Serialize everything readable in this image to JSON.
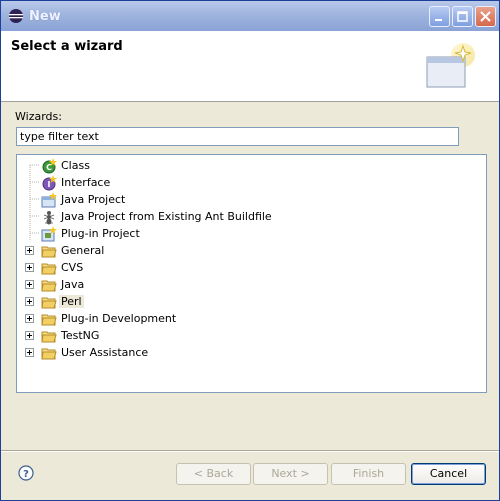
{
  "window": {
    "title": "New"
  },
  "header": {
    "title": "Select a wizard"
  },
  "wizards": {
    "label": "Wizards:",
    "filter_value": "type filter text",
    "tree": {
      "children": [
        {
          "label": "Class",
          "icon": "class-icon"
        },
        {
          "label": "Interface",
          "icon": "interface-icon"
        },
        {
          "label": "Java Project",
          "icon": "java-project-icon"
        },
        {
          "label": "Java Project from Existing Ant Buildfile",
          "icon": "ant-icon"
        },
        {
          "label": "Plug-in Project",
          "icon": "plugin-project-icon"
        }
      ],
      "folders": [
        {
          "label": "General"
        },
        {
          "label": "CVS"
        },
        {
          "label": "Java"
        },
        {
          "label": "Perl"
        },
        {
          "label": "Plug-in Development"
        },
        {
          "label": "TestNG"
        },
        {
          "label": "User Assistance"
        }
      ]
    }
  },
  "buttons": {
    "back": "< Back",
    "next": "Next >",
    "finish": "Finish",
    "cancel": "Cancel"
  },
  "colors": {
    "title_bar": "#9fb4de",
    "folder": "#e8c35a",
    "selection": "#ece9d8"
  }
}
